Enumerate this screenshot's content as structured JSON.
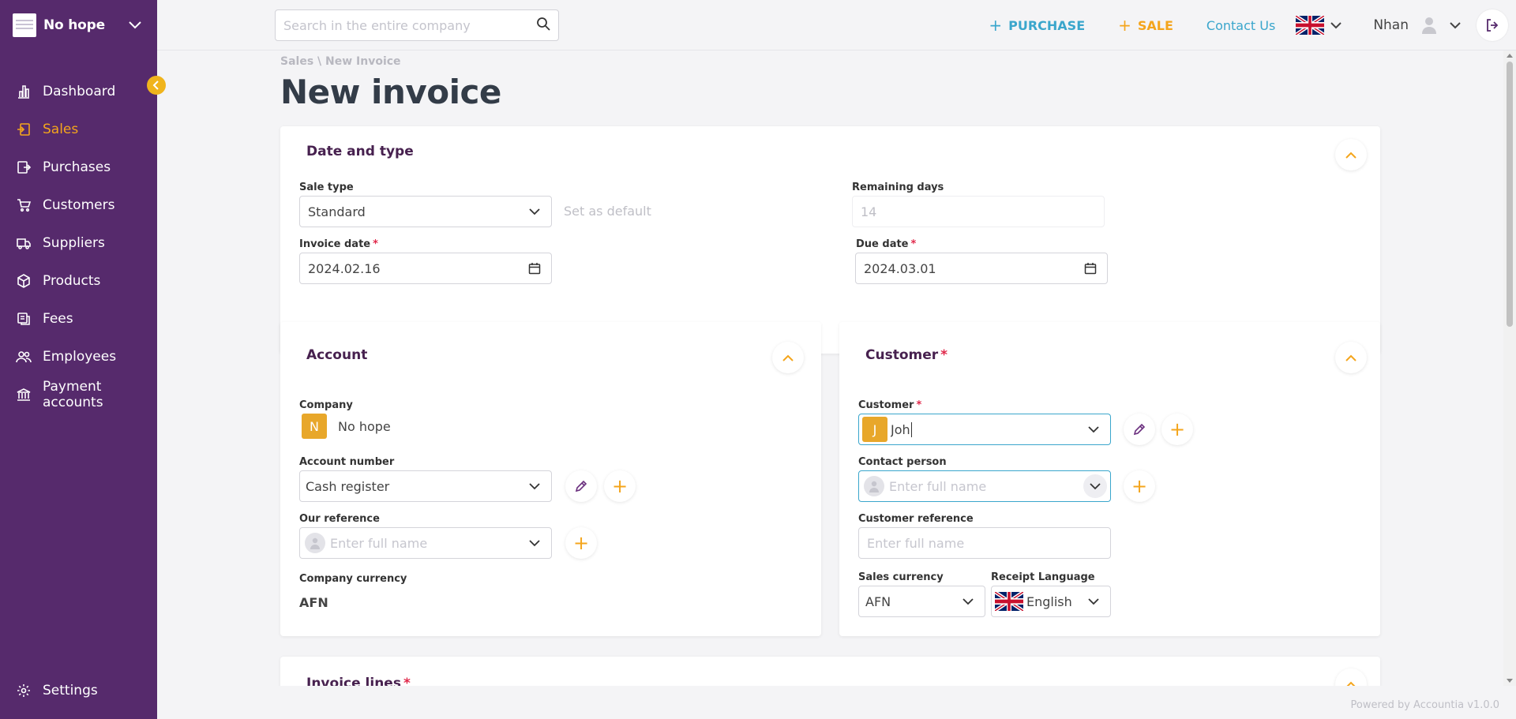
{
  "app": {
    "company_name": "No hope"
  },
  "sidebar": {
    "items": [
      {
        "label": "Dashboard",
        "icon": "chart-bar-icon",
        "active": false
      },
      {
        "label": "Sales",
        "icon": "sales-icon",
        "active": true
      },
      {
        "label": "Purchases",
        "icon": "purchases-icon",
        "active": false
      },
      {
        "label": "Customers",
        "icon": "cart-icon",
        "active": false
      },
      {
        "label": "Suppliers",
        "icon": "truck-icon",
        "active": false
      },
      {
        "label": "Products",
        "icon": "box-icon",
        "active": false
      },
      {
        "label": "Fees",
        "icon": "coins-icon",
        "active": false
      },
      {
        "label": "Employees",
        "icon": "users-icon",
        "active": false
      },
      {
        "label": "Payment accounts",
        "icon": "bank-icon",
        "active": false
      }
    ],
    "settings_label": "Settings"
  },
  "topbar": {
    "search_placeholder": "Search in the entire company",
    "purchase_label": "PURCHASE",
    "sale_label": "SALE",
    "contact_label": "Contact Us",
    "user_name": "Nhan"
  },
  "page": {
    "breadcrumb": "Sales \\ New Invoice",
    "title": "New invoice"
  },
  "date_type": {
    "title": "Date and type",
    "sale_type_label": "Sale type",
    "sale_type_value": "Standard",
    "set_default_label": "Set as default",
    "remaining_days_label": "Remaining days",
    "remaining_days_value": "14",
    "invoice_date_label": "Invoice date",
    "invoice_date_value": "2024.02.16",
    "due_date_label": "Due date",
    "due_date_value": "2024.03.01"
  },
  "account": {
    "title": "Account",
    "company_label": "Company",
    "company_initial": "N",
    "company_value": "No hope",
    "account_number_label": "Account number",
    "account_number_value": "Cash register",
    "our_reference_label": "Our reference",
    "our_reference_placeholder": "Enter full name",
    "company_currency_label": "Company currency",
    "company_currency_value": "AFN"
  },
  "customer": {
    "title": "Customer",
    "customer_label": "Customer",
    "customer_initial": "J",
    "customer_value": "Joh",
    "contact_person_label": "Contact person",
    "contact_person_placeholder": "Enter full name",
    "customer_reference_label": "Customer reference",
    "customer_reference_placeholder": "Enter full name",
    "sales_currency_label": "Sales currency",
    "sales_currency_value": "AFN",
    "receipt_language_label": "Receipt Language",
    "receipt_language_value": "English"
  },
  "invoice_lines": {
    "title": "Invoice lines"
  },
  "footer": {
    "powered_by": "Powered by Accountia v1.0.0"
  },
  "colors": {
    "sidebar": "#562a6c",
    "accent": "#f4a51c",
    "link": "#3aa6cc",
    "required": "#e0284a"
  }
}
